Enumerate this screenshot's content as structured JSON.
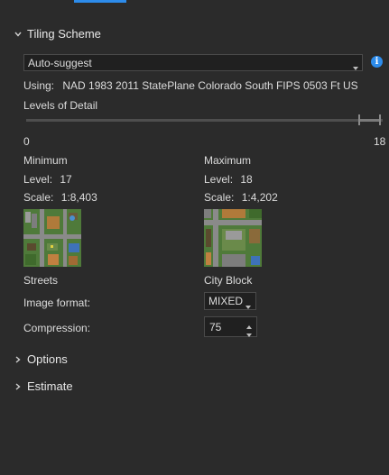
{
  "tiling_scheme": {
    "header": "Tiling Scheme",
    "dropdown_value": "Auto-suggest",
    "using_label": "Using:",
    "using_value": "NAD 1983 2011 StatePlane Colorado South FIPS 0503 Ft US"
  },
  "lod": {
    "label": "Levels of Detail",
    "min_tick": "0",
    "max_tick": "18",
    "range_low": 17,
    "range_high": 18
  },
  "minimum": {
    "title": "Minimum",
    "level_label": "Level:",
    "level_value": "17",
    "scale_label": "Scale:",
    "scale_value": "1:8,403",
    "caption": "Streets"
  },
  "maximum": {
    "title": "Maximum",
    "level_label": "Level:",
    "level_value": "18",
    "scale_label": "Scale:",
    "scale_value": "1:4,202",
    "caption": "City Block"
  },
  "image_format": {
    "label": "Image format:",
    "value": "MIXED"
  },
  "compression": {
    "label": "Compression:",
    "value": "75"
  },
  "sections": {
    "options": "Options",
    "estimate": "Estimate"
  },
  "colors": {
    "accent": "#2d8ceb",
    "background": "#2b2b2b"
  }
}
